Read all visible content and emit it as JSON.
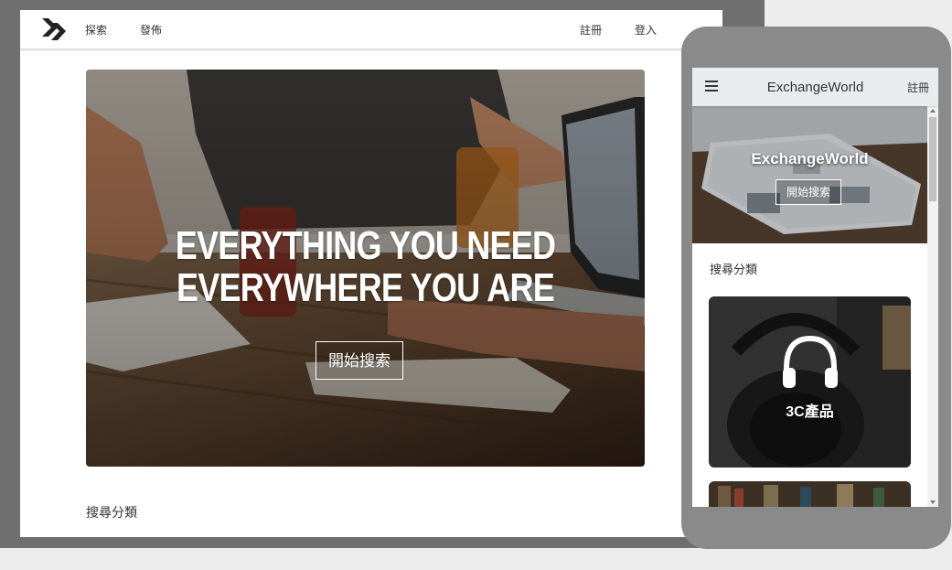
{
  "desktop": {
    "nav": {
      "explore": "探索",
      "publish": "發佈",
      "register": "註冊",
      "login": "登入"
    },
    "hero": {
      "line1": "EVERYTHING YOU NEED",
      "line2": "EVERYWHERE YOU ARE",
      "cta": "開始搜索"
    },
    "section_title": "搜尋分類"
  },
  "mobile": {
    "nav": {
      "menu_icon": "hamburger-icon",
      "brand": "ExchangeWorld",
      "register": "註冊"
    },
    "hero": {
      "title": "ExchangeWorld",
      "cta": "開始搜索"
    },
    "section_title": "搜尋分類",
    "categories": [
      {
        "label": "3C產品",
        "icon": "headphones-icon"
      }
    ]
  },
  "colors": {
    "mobile_nav_bg": "#e9ecef",
    "frame_dark": "#6f6f6f",
    "frame_phone": "#8a8a8a"
  }
}
